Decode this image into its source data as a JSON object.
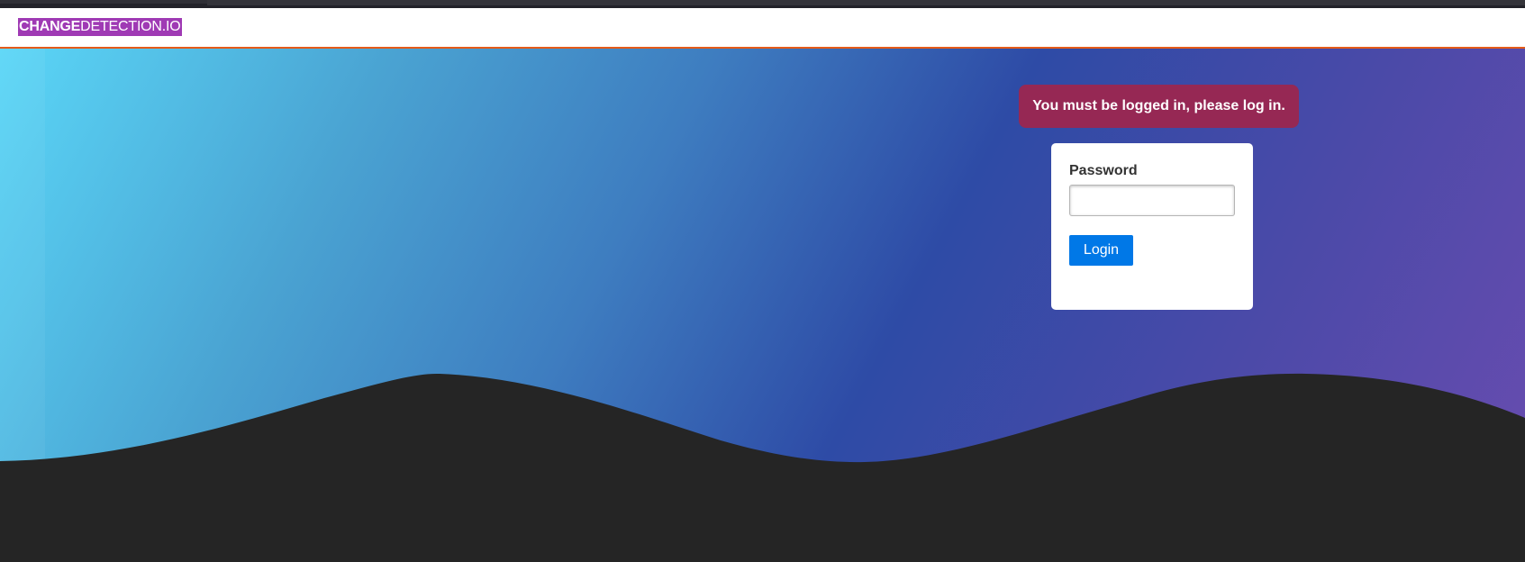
{
  "header": {
    "logo_strong": "CHANGE",
    "logo_light": "DETECTION.IO"
  },
  "flash": {
    "message": "You must be logged in, please log in."
  },
  "login_form": {
    "password_label": "Password",
    "password_value": "",
    "login_button_label": "Login"
  },
  "colors": {
    "header_accent": "#e55b19",
    "logo_bg": "#9f3ab4",
    "flash_bg": "#962854",
    "login_button": "#0078e7",
    "footer_bg": "#252525"
  }
}
